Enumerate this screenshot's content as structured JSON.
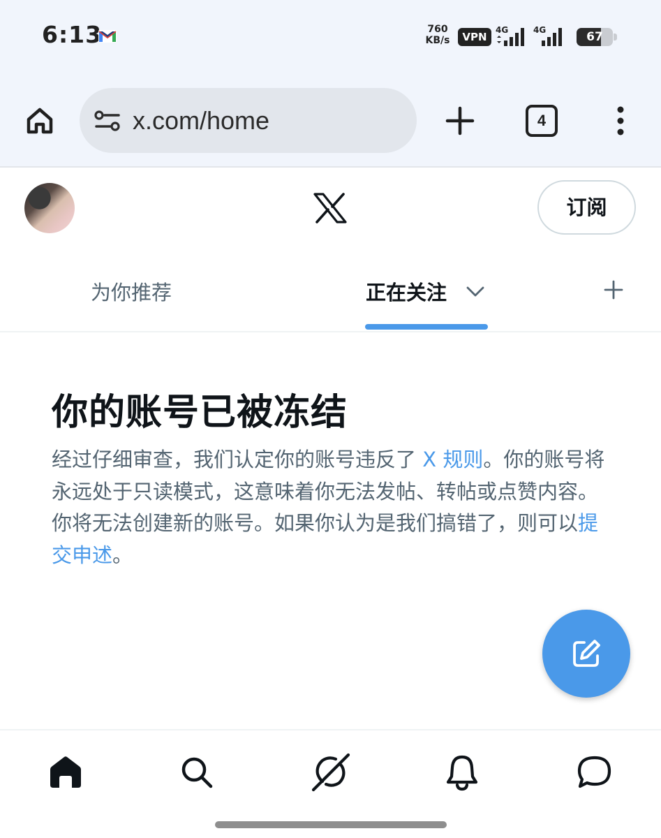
{
  "status_bar": {
    "time": "6:13",
    "net_speed_value": "760",
    "net_speed_unit": "KB/s",
    "vpn": "VPN",
    "signal_1_label": "4G",
    "signal_2_label": "4G",
    "battery": "67",
    "battery_level": 0.67
  },
  "browser": {
    "url": "x.com/home",
    "tab_count": "4"
  },
  "header": {
    "subscribe_label": "订阅"
  },
  "tabs": [
    {
      "label": "为你推荐",
      "active": false
    },
    {
      "label": "正在关注",
      "active": true
    }
  ],
  "notice": {
    "title": "你的账号已被冻结",
    "body_part1": "经过仔细审查，我们认定你的账号违反了 ",
    "rules_link": "X 规则",
    "body_part2": "。你的账号将永远处于只读模式，这意味着你无法发帖、转帖或点赞内容。你将无法创建新的账号。如果你认为是我们搞错了，则可以",
    "appeal_link": "提交申述",
    "body_part3": "。"
  },
  "colors": {
    "accent": "#4a99e9",
    "text_primary": "#0f1419",
    "text_secondary": "#536471"
  },
  "icons": {
    "browser": [
      "home-icon",
      "tune-icon",
      "plus-icon",
      "tab-count-icon",
      "more-vert-icon"
    ],
    "bottom_nav": [
      "home-icon",
      "search-icon",
      "grok-icon",
      "bell-icon",
      "message-icon"
    ],
    "fab": "compose-icon"
  }
}
